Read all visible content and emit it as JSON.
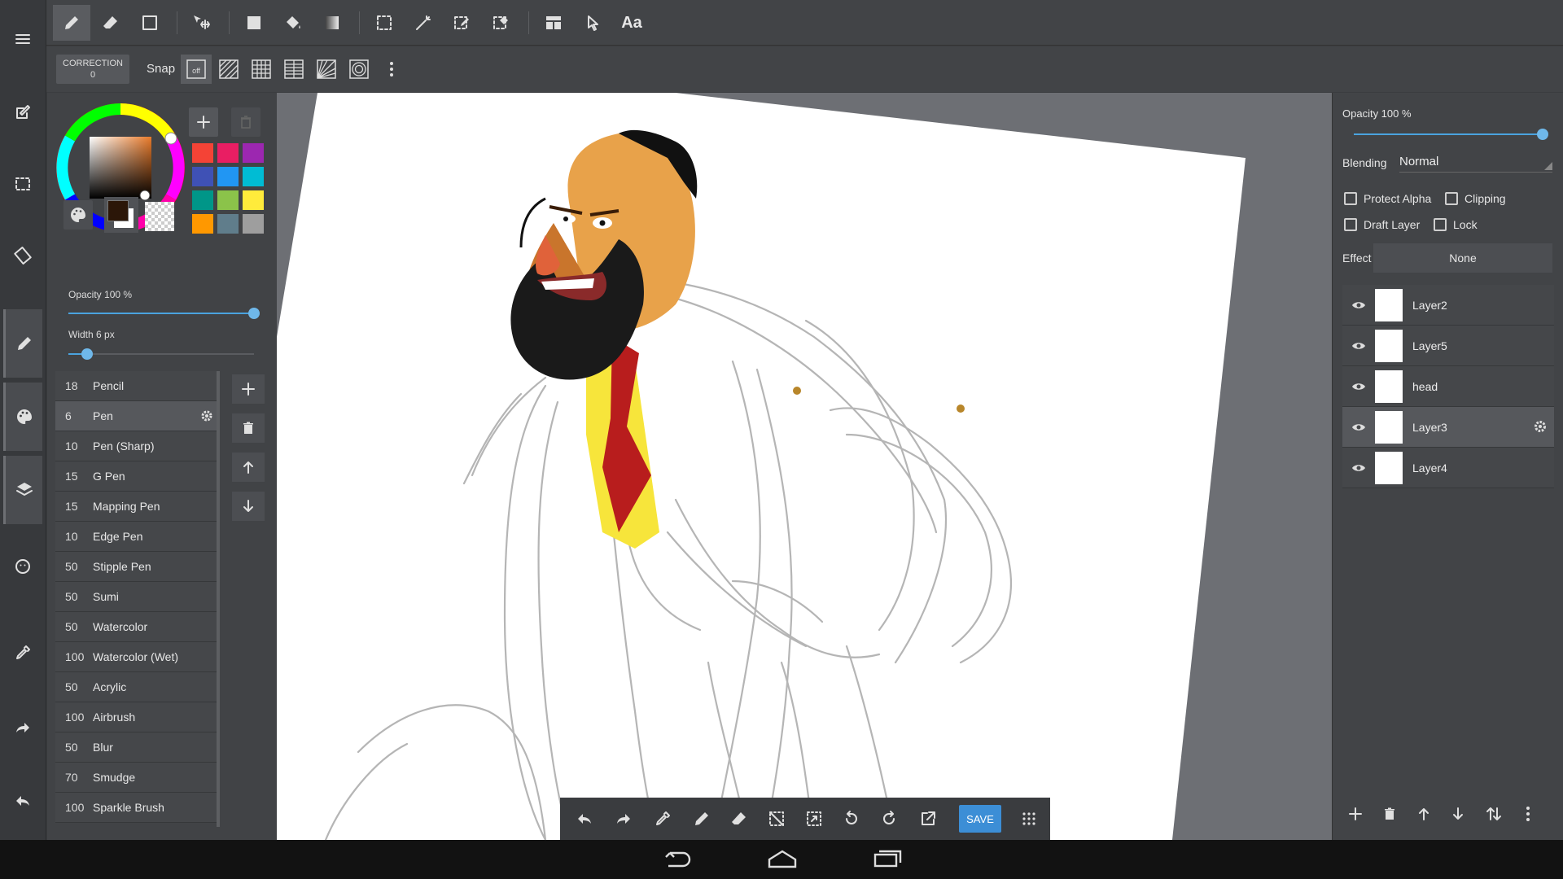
{
  "top_tools": [
    {
      "name": "pen-tool",
      "icon": "pen-icon",
      "active": true
    },
    {
      "name": "eraser-tool",
      "icon": "eraser-icon"
    },
    {
      "name": "shape-tool",
      "icon": "square-outline-icon"
    },
    {
      "name": "move-tool",
      "icon": "move-icon"
    },
    {
      "name": "fill-rect-tool",
      "icon": "filled-square-icon"
    },
    {
      "name": "bucket-tool",
      "icon": "paint-bucket-icon"
    },
    {
      "name": "gradient-tool",
      "icon": "gradient-icon"
    },
    {
      "name": "select-tool",
      "icon": "selection-icon"
    },
    {
      "name": "magic-wand-tool",
      "icon": "magic-wand-icon"
    },
    {
      "name": "select-pen-tool",
      "icon": "select-pen-icon"
    },
    {
      "name": "select-eraser-tool",
      "icon": "select-eraser-icon"
    },
    {
      "name": "frame-tool",
      "icon": "frame-icon"
    },
    {
      "name": "operation-tool",
      "icon": "pointer-icon"
    }
  ],
  "text_tool_label": "Aa",
  "correction": {
    "label": "CORRECTION",
    "value": "0"
  },
  "snap": {
    "label": "Snap",
    "off_label": "off"
  },
  "color": {
    "current": "#2b1608",
    "secondary": "transparent",
    "palette": [
      "#f44336",
      "#e91e63",
      "#9c27b0",
      "#3f51b5",
      "#2196f3",
      "#00bcd4",
      "#009688",
      "#8bc34a",
      "#ffeb3b",
      "#ff9800",
      "#607d8b",
      "#9e9e9e"
    ]
  },
  "brush_settings": {
    "opacity_label": "Opacity 100 %",
    "opacity": 1.0,
    "width_label": "Width 6 px",
    "width_fraction": 0.1
  },
  "brushes": [
    {
      "size": "18",
      "name": "Pencil"
    },
    {
      "size": "6",
      "name": "Pen",
      "selected": true
    },
    {
      "size": "10",
      "name": "Pen (Sharp)"
    },
    {
      "size": "15",
      "name": "G Pen"
    },
    {
      "size": "15",
      "name": "Mapping Pen"
    },
    {
      "size": "10",
      "name": "Edge Pen"
    },
    {
      "size": "50",
      "name": "Stipple Pen"
    },
    {
      "size": "50",
      "name": "Sumi"
    },
    {
      "size": "50",
      "name": "Watercolor"
    },
    {
      "size": "100",
      "name": "Watercolor (Wet)"
    },
    {
      "size": "50",
      "name": "Acrylic"
    },
    {
      "size": "100",
      "name": "Airbrush"
    },
    {
      "size": "50",
      "name": "Blur"
    },
    {
      "size": "70",
      "name": "Smudge"
    },
    {
      "size": "100",
      "name": "Sparkle Brush"
    }
  ],
  "layer_props": {
    "opacity_label": "Opacity 100 %",
    "opacity": 1.0,
    "blending_label": "Blending",
    "blending_value": "Normal",
    "protect_alpha": "Protect Alpha",
    "clipping": "Clipping",
    "draft_layer": "Draft Layer",
    "lock": "Lock",
    "effect_label": "Effect",
    "effect_value": "None"
  },
  "layers": [
    {
      "name": "Layer2"
    },
    {
      "name": "Layer5"
    },
    {
      "name": "head"
    },
    {
      "name": "Layer3",
      "selected": true
    },
    {
      "name": "Layer4"
    }
  ],
  "bottom_bar": {
    "save_label": "SAVE"
  }
}
